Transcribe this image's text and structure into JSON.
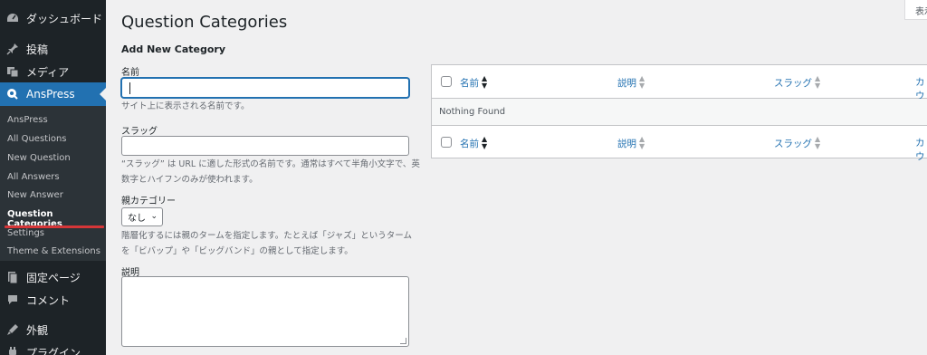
{
  "sidebar": {
    "items": [
      {
        "label": "ダッシュボード",
        "icon": "dashboard-icon"
      },
      {
        "label": "投稿",
        "icon": "pin-icon"
      },
      {
        "label": "メディア",
        "icon": "media-icon"
      },
      {
        "label": "AnsPress",
        "icon": "anspress-icon",
        "active": true
      }
    ],
    "submenu": [
      "AnsPress",
      "All Questions",
      "New Question",
      "All Answers",
      "New Answer",
      "Question Categories",
      "Settings",
      "Theme & Extensions"
    ],
    "lower_items": [
      {
        "label": "固定ページ",
        "icon": "page-icon"
      },
      {
        "label": "コメント",
        "icon": "comment-icon"
      },
      {
        "label": "外観",
        "icon": "appearance-icon"
      },
      {
        "label": "プラグイン",
        "icon": "plugin-icon"
      }
    ]
  },
  "header": {
    "title": "Question Categories",
    "screen_options": "表示"
  },
  "form": {
    "title": "Add New Category",
    "name_label": "名前",
    "name_value": "",
    "name_help": "サイト上に表示される名前です。",
    "slug_label": "スラッグ",
    "slug_value": "",
    "slug_help": "“スラッグ” は URL に適した形式の名前です。通常はすべて半角小文字で、英数字とハイフンのみが使われます。",
    "parent_label": "親カテゴリー",
    "parent_value": "なし",
    "parent_help": "階層化するには親のタームを指定します。たとえば「ジャズ」というタームを「ビバップ」や「ビッグバンド」の親として指定します。",
    "desc_label": "説明",
    "desc_value": ""
  },
  "table": {
    "columns": [
      "名前",
      "説明",
      "スラッグ",
      "カウ"
    ],
    "empty_text": "Nothing Found"
  },
  "colors": {
    "accent": "#2271b1",
    "sidebar_bg": "#1d2327",
    "highlight": "#d63638"
  }
}
